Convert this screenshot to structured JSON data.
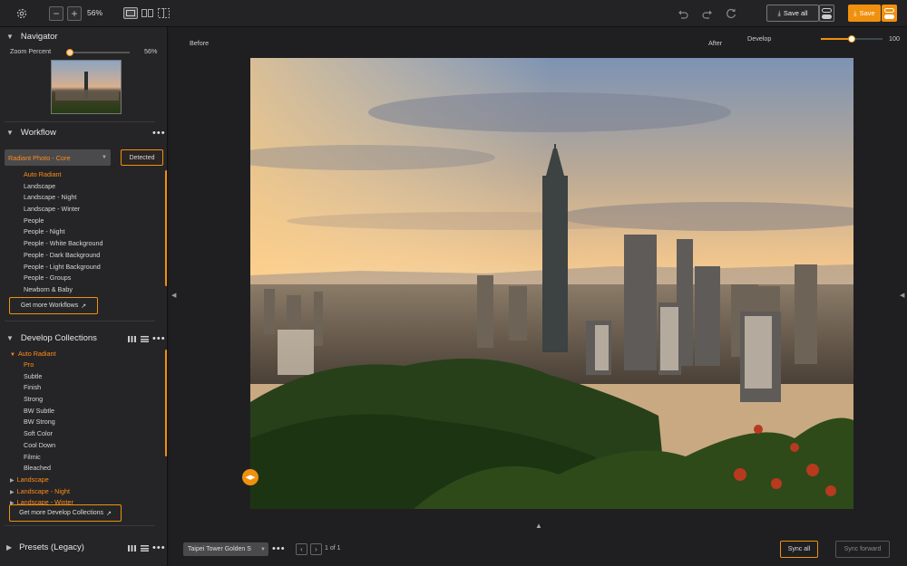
{
  "toolbar": {
    "zoom_value": "56%",
    "save_all_label": "Save all",
    "save_label": "Save"
  },
  "header": {
    "before_label": "Before",
    "after_label": "After",
    "develop_label": "Develop",
    "develop_value": "100",
    "develop_level": 1.0
  },
  "navigator": {
    "title": "Navigator",
    "zoom_label": "Zoom Percent",
    "zoom_value": "56%",
    "zoom_level": 0.56
  },
  "workflow": {
    "title": "Workflow",
    "dropdown_value": "Radiant Photo - Core",
    "detected_label": "Detected",
    "items": [
      "Auto Radiant",
      "Landscape",
      "Landscape - Night",
      "Landscape - Winter",
      "People",
      "People - Night",
      "People - White Background",
      "People - Dark Background",
      "People - Light Background",
      "People - Groups",
      "Newborn & Baby"
    ],
    "get_more_label": "Get more Workflows"
  },
  "develop_collections": {
    "title": "Develop Collections",
    "group": "Auto Radiant",
    "items": [
      "Pro",
      "Subtle",
      "Finish",
      "Strong",
      "BW Subtle",
      "BW Strong",
      "Soft Color",
      "Cool Down",
      "Filmic",
      "Bleached"
    ],
    "sub_groups": [
      "Landscape",
      "Landscape - Night",
      "Landscape - Winter"
    ],
    "get_more_label": "Get more Develop Collections"
  },
  "presets": {
    "title": "Presets (Legacy)"
  },
  "bottom": {
    "filename": "Taipei Tower Golden S",
    "page": "1 of 1",
    "sync_all_label": "Sync all",
    "sync_forward_label": "Sync forward"
  },
  "colors": {
    "accent": "#f0900f",
    "panel": "#252527",
    "background": "#1c1c1e"
  }
}
